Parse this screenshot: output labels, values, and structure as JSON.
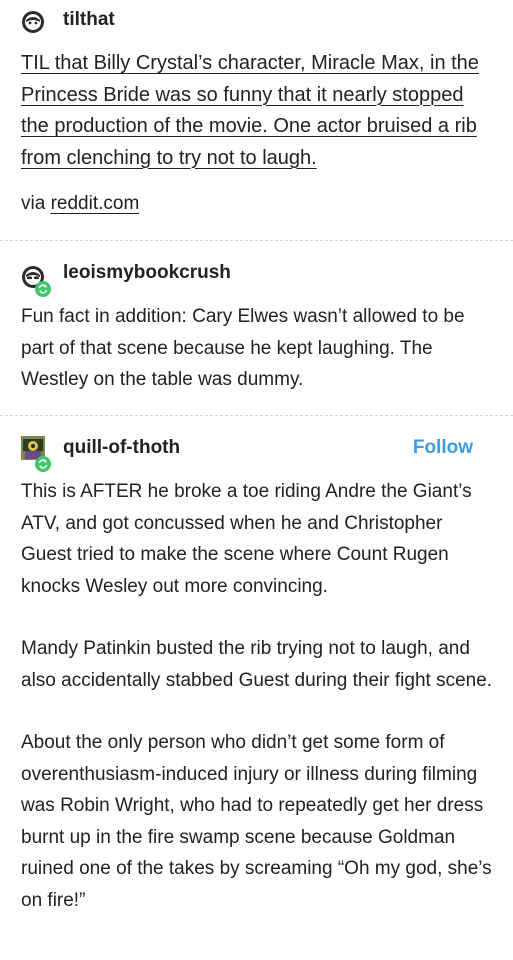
{
  "post1": {
    "username": "tilthat",
    "title": "TIL that Billy Crystal’s character, Miracle Max, in the Princess Bride was so funny that it nearly stopped the production of the movie. One actor bruised a rib from clenching to try not to laugh.",
    "via_label": "via",
    "via_link": "reddit.com"
  },
  "post2": {
    "username": "leoismybookcrush",
    "body": "Fun fact in addition: Cary Elwes wasn’t allowed to be part of that scene because he kept laughing. The Westley on the table was dummy."
  },
  "post3": {
    "username": "quill-of-thoth",
    "follow_label": "Follow",
    "paragraphs": [
      "This is AFTER he broke a toe riding Andre the Giant’s ATV, and got concussed when he and Christopher Guest tried to make the scene where Count Rugen knocks Wesley out more convincing.",
      "Mandy Patinkin busted the rib trying not to laugh, and also accidentally stabbed Guest during their fight scene.",
      "About the only person who didn’t get some form of overenthusiasm-induced injury or illness during filming was Robin Wright, who had to repeatedly get her dress burnt up in the fire swamp scene because Goldman ruined one of the takes by screaming “Oh my god, she’s on fire!”"
    ]
  },
  "colors": {
    "accent": "#3b9cde",
    "reblog_badge": "#3fc66b",
    "text": "#222222"
  }
}
